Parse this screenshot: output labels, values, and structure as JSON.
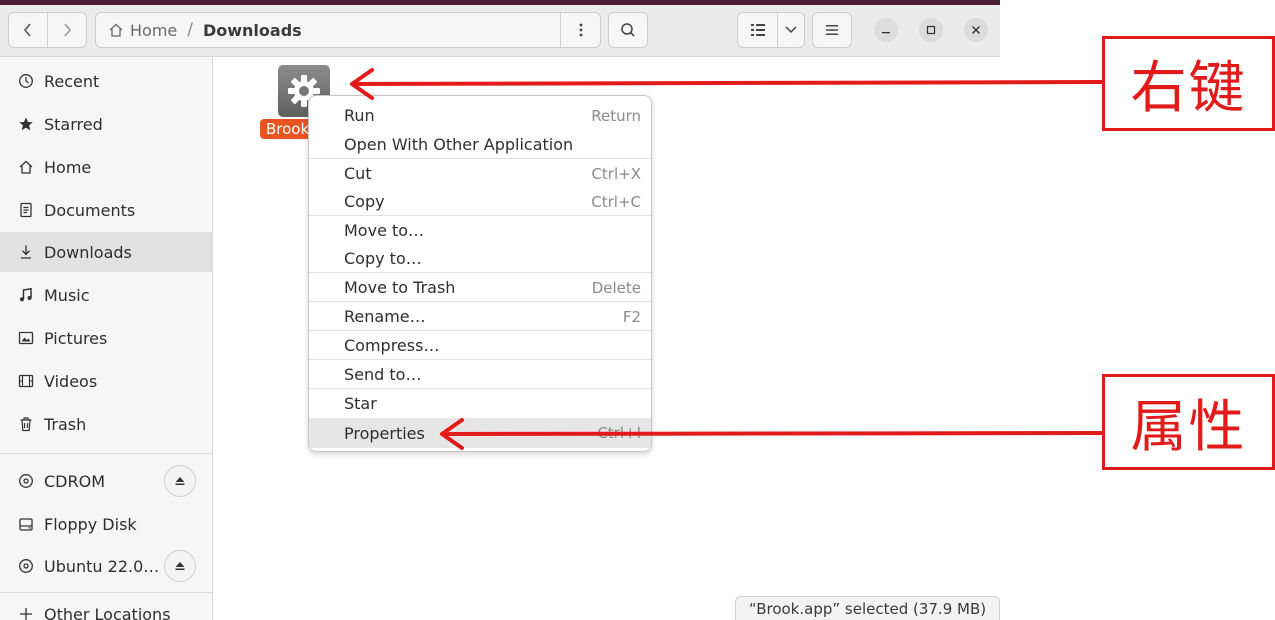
{
  "breadcrumb": {
    "home": "Home",
    "separator": "/",
    "current": "Downloads"
  },
  "sidebar": {
    "items": [
      {
        "label": "Recent",
        "icon": "clock-icon"
      },
      {
        "label": "Starred",
        "icon": "star-icon"
      },
      {
        "label": "Home",
        "icon": "home-icon"
      },
      {
        "label": "Documents",
        "icon": "document-icon"
      },
      {
        "label": "Downloads",
        "icon": "download-icon",
        "active": true
      },
      {
        "label": "Music",
        "icon": "music-icon"
      },
      {
        "label": "Pictures",
        "icon": "picture-icon"
      },
      {
        "label": "Videos",
        "icon": "video-icon"
      },
      {
        "label": "Trash",
        "icon": "trash-icon"
      }
    ],
    "devices": [
      {
        "label": "CDROM",
        "icon": "disc-icon",
        "eject": true
      },
      {
        "label": "Floppy Disk",
        "icon": "drive-icon",
        "eject": false
      },
      {
        "label": "Ubuntu 22.0…",
        "icon": "disc-icon",
        "eject": true
      }
    ],
    "other": {
      "label": "Other Locations",
      "icon": "plus-icon"
    }
  },
  "file": {
    "name": "Brook",
    "icon": "gear-icon"
  },
  "context_menu": {
    "items": [
      {
        "label": "Run",
        "accel": "Return"
      },
      {
        "label": "Open With Other Application",
        "accel": ""
      },
      {
        "label": "Cut",
        "accel": "Ctrl+X"
      },
      {
        "label": "Copy",
        "accel": "Ctrl+C"
      },
      {
        "label": "Move to…",
        "accel": ""
      },
      {
        "label": "Copy to…",
        "accel": ""
      },
      {
        "label": "Move to Trash",
        "accel": "Delete"
      },
      {
        "label": "Rename…",
        "accel": "F2"
      },
      {
        "label": "Compress…",
        "accel": ""
      },
      {
        "label": "Send to…",
        "accel": ""
      },
      {
        "label": "Star",
        "accel": ""
      },
      {
        "label": "Properties",
        "accel": "Ctrl+I",
        "hovered": true
      }
    ]
  },
  "status": {
    "text": "“Brook.app” selected  (37.9 MB)"
  },
  "annotations": {
    "right_click": "右键",
    "properties": "属性",
    "color": "#e21a1a"
  },
  "colors": {
    "accent": "#e95420",
    "titlebar": "#4a1f36"
  }
}
